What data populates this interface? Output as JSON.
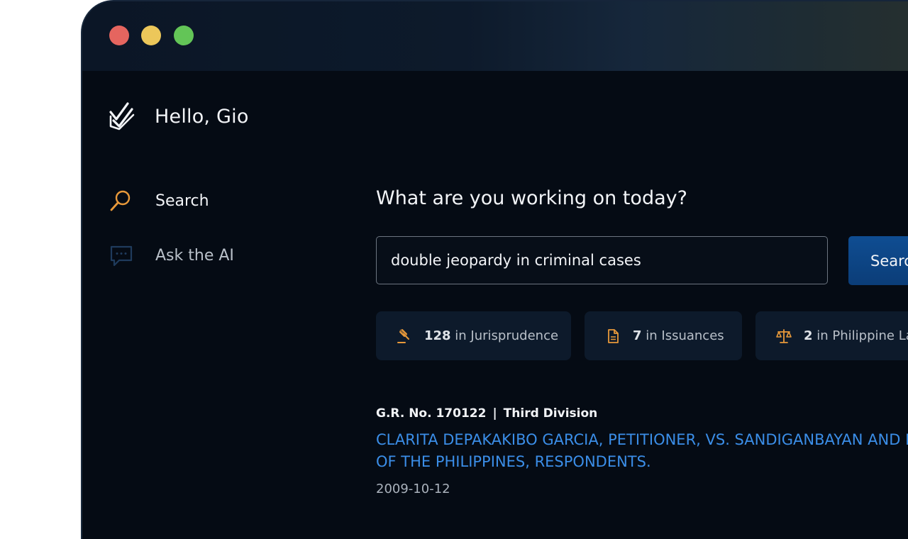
{
  "window": {
    "controls": [
      "close",
      "minimize",
      "maximize"
    ],
    "colors": {
      "close": "#e5655f",
      "minimize": "#ecc75a",
      "maximize": "#63c557"
    }
  },
  "header": {
    "logo_icon": "checkmark-logo-icon",
    "greeting": "Hello, Gio"
  },
  "sidebar": {
    "items": [
      {
        "label": "Search",
        "icon": "search-icon",
        "active": true
      },
      {
        "label": "Ask the AI",
        "icon": "chat-icon",
        "active": false
      }
    ]
  },
  "main": {
    "prompt": "What are you working on today?",
    "search": {
      "value": "double jeopardy in criminal cases",
      "button_label": "Search"
    },
    "filters": [
      {
        "count": "128",
        "label": " in Jurisprudence",
        "icon": "gavel-icon"
      },
      {
        "count": "7",
        "label": " in Issuances",
        "icon": "document-icon"
      },
      {
        "count": "2",
        "label": " in Philippine Laws",
        "icon": "scales-icon"
      }
    ],
    "result": {
      "gr_number": "G.R. No. 170122",
      "separator": "|",
      "division": "Third Division",
      "title_line1": "CLARITA DEPAKAKIBO GARCIA, PETITIONER, VS. SANDIGANBAYAN AND REPUBLIC",
      "title_line2": "OF THE PHILIPPINES, RESPONDENTS.",
      "date": "2009-10-12"
    }
  },
  "colors": {
    "background": "#050b14",
    "accent_orange": "#e8993a",
    "link_blue": "#3b8ee8",
    "button_blue": "#0f4d92"
  }
}
